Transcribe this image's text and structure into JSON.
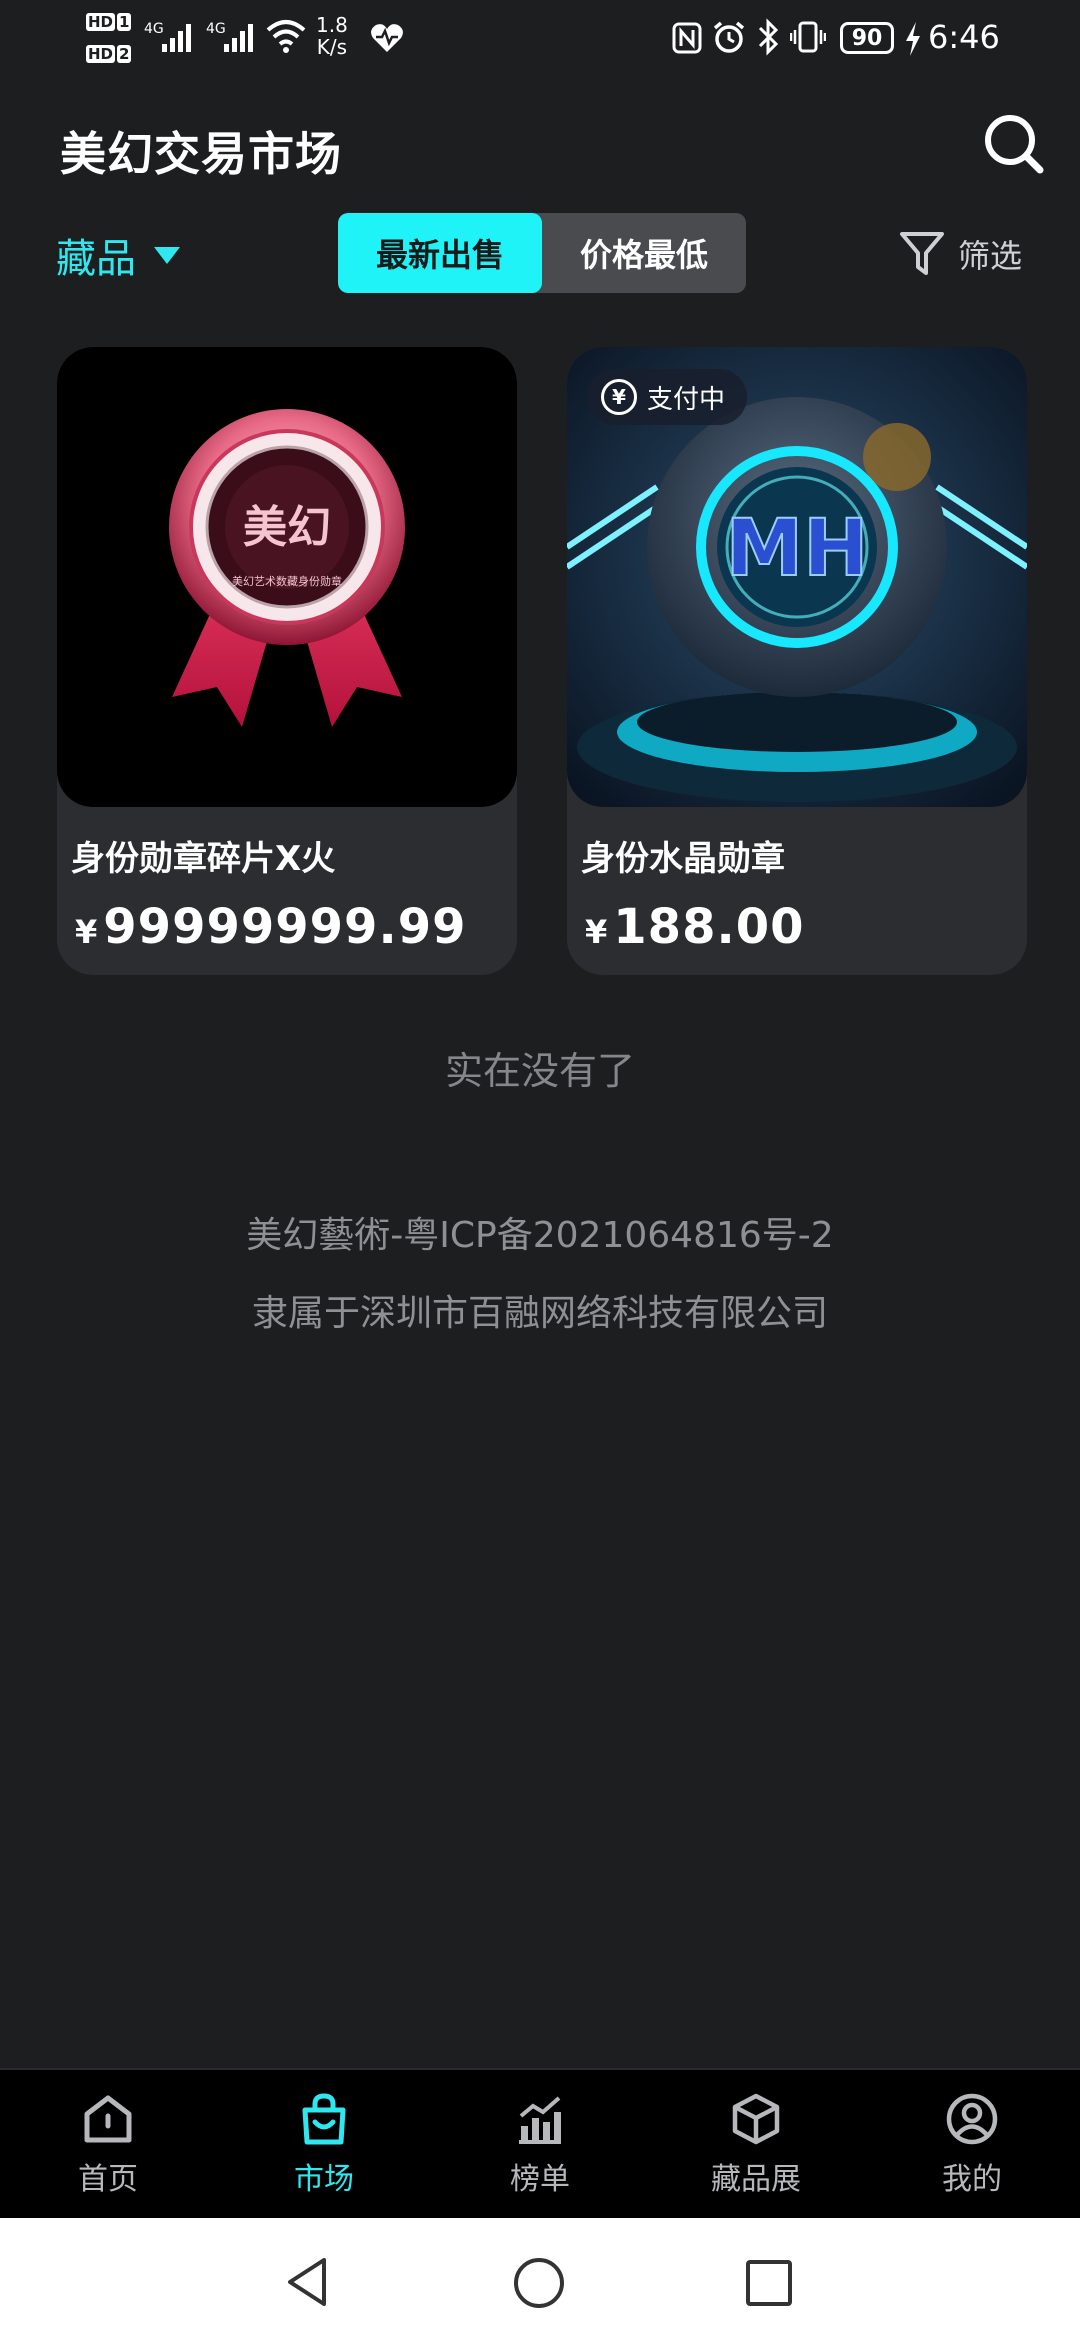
{
  "status_bar": {
    "hd1": "HD",
    "hd1_num": "1",
    "hd2": "HD",
    "hd2_num": "2",
    "signal1": "4G",
    "signal2": "4G",
    "speed_value": "1.8",
    "speed_unit": "K/s",
    "battery": "90",
    "time": "6:46"
  },
  "header": {
    "title": "美幻交易市场",
    "search_icon": "search-icon"
  },
  "filters": {
    "category": "藏品",
    "sort_tabs": [
      {
        "label": "最新出售",
        "active": true
      },
      {
        "label": "价格最低",
        "active": false
      }
    ],
    "filter_label": "筛选",
    "accent_color": "#2fe7ef"
  },
  "products": [
    {
      "name": "身份勋章碎片X火",
      "currency": "¥",
      "price": "99999999.99",
      "medal_text": "美幻",
      "medal_ring_text": "美幻艺术数藏身份勋章"
    },
    {
      "name": "身份水晶勋章",
      "currency": "¥",
      "price": "188.00",
      "badge": "支付中",
      "badge_icon": "¥",
      "emblem_text": "MH"
    }
  ],
  "footer": {
    "no_more": "实在没有了",
    "icp": "美幻藝術-粤ICP备2021064816号-2",
    "company": "隶属于深圳市百融网络科技有限公司"
  },
  "bottom_nav": [
    {
      "label": "首页",
      "icon": "home-icon",
      "active": false
    },
    {
      "label": "市场",
      "icon": "shopping-bag-icon",
      "active": true
    },
    {
      "label": "榜单",
      "icon": "chart-icon",
      "active": false
    },
    {
      "label": "藏品展",
      "icon": "cube-icon",
      "active": false
    },
    {
      "label": "我的",
      "icon": "user-icon",
      "active": false
    }
  ]
}
